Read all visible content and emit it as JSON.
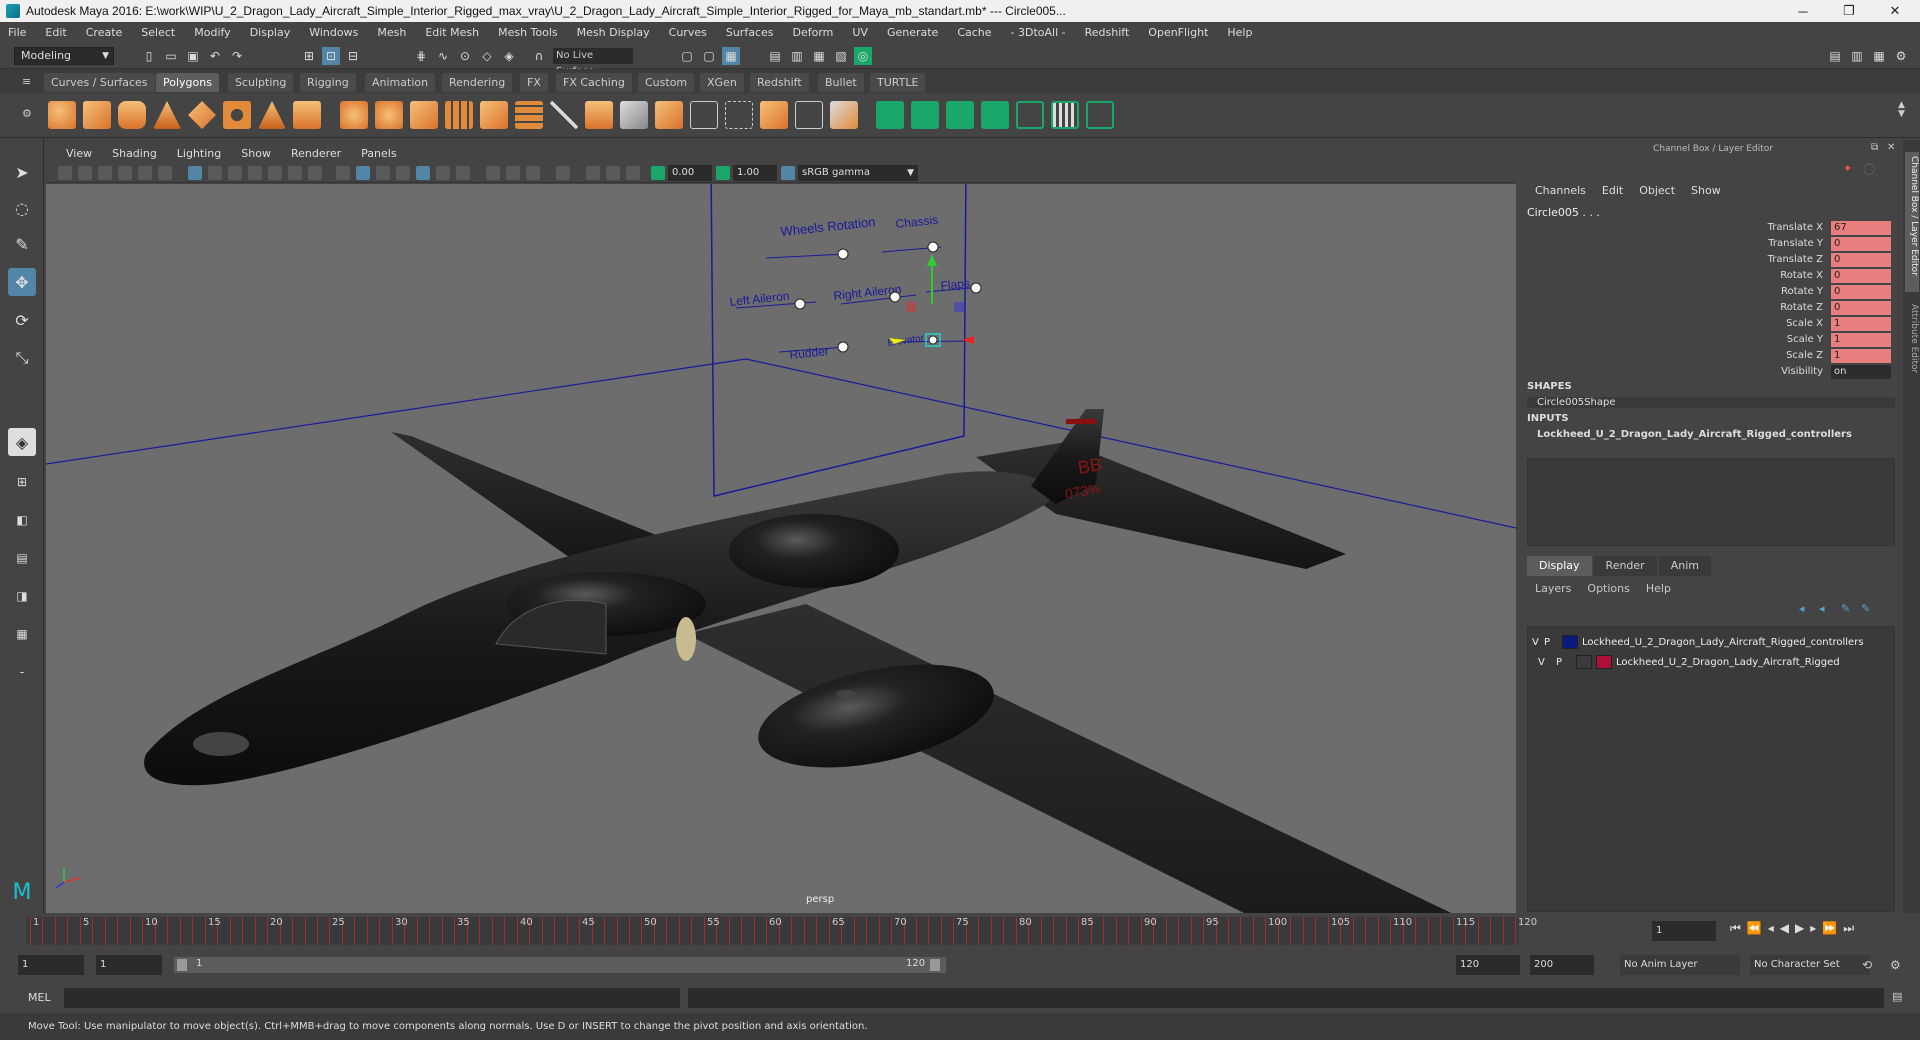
{
  "window": {
    "title": "Autodesk Maya 2016: E:\\work\\WIP\\U_2_Dragon_Lady_Aircraft_Simple_Interior_Rigged_max_vray\\U_2_Dragon_Lady_Aircraft_Simple_Interior_Rigged_for_Maya_mb_standart.mb*  ---  Circle005...",
    "minimize": "─",
    "restore": "❐",
    "close": "✕"
  },
  "menubar": [
    "File",
    "Edit",
    "Create",
    "Select",
    "Modify",
    "Display",
    "Windows",
    "Mesh",
    "Edit Mesh",
    "Mesh Tools",
    "Mesh Display",
    "Curves",
    "Surfaces",
    "Deform",
    "UV",
    "Generate",
    "Cache",
    "- 3DtoAll -",
    "Redshift",
    "OpenFlight",
    "Help"
  ],
  "status": {
    "mode": "Modeling",
    "live_surface": "No Live Surface"
  },
  "shelf_tabs": [
    "Curves / Surfaces",
    "Polygons",
    "Sculpting",
    "Rigging",
    "Animation",
    "Rendering",
    "FX",
    "FX Caching",
    "Custom",
    "XGen",
    "Redshift",
    "Bullet",
    "TURTLE"
  ],
  "shelf_active": "Polygons",
  "viewport": {
    "menu": [
      "View",
      "Shading",
      "Lighting",
      "Show",
      "Renderer",
      "Panels"
    ],
    "near": "0.00",
    "far": "1.00",
    "colorspace": "sRGB gamma",
    "camera_label": "persp",
    "controls": {
      "wheels_rotation": "Wheels Rotation",
      "chassis": "Chassis",
      "left_aileron": "Left Aileron",
      "right_aileron": "Right Aileron",
      "flaps": "Flaps",
      "rudder": "Rudder",
      "elevator": "Elevator"
    },
    "tail_code_top": "BB",
    "tail_code_bottom": "073%"
  },
  "channel_box": {
    "header": "Channel Box / Layer Editor",
    "menu": [
      "Channels",
      "Edit",
      "Object",
      "Show"
    ],
    "object": "Circle005 . . .",
    "attributes": [
      {
        "label": "Translate X",
        "value": "67",
        "highlight": true
      },
      {
        "label": "Translate Y",
        "value": "0",
        "highlight": true
      },
      {
        "label": "Translate Z",
        "value": "0",
        "highlight": true
      },
      {
        "label": "Rotate X",
        "value": "0",
        "highlight": true
      },
      {
        "label": "Rotate Y",
        "value": "0",
        "highlight": true
      },
      {
        "label": "Rotate Z",
        "value": "0",
        "highlight": true
      },
      {
        "label": "Scale X",
        "value": "1",
        "highlight": true
      },
      {
        "label": "Scale Y",
        "value": "1",
        "highlight": true
      },
      {
        "label": "Scale Z",
        "value": "1",
        "highlight": true
      },
      {
        "label": "Visibility",
        "value": "on",
        "highlight": false
      }
    ],
    "shapes_title": "SHAPES",
    "shape": "Circle005Shape",
    "inputs_title": "INPUTS",
    "input": "Lockheed_U_2_Dragon_Lady_Aircraft_Rigged_controllers"
  },
  "layer_editor": {
    "tabs": [
      "Display",
      "Render",
      "Anim"
    ],
    "menu": [
      "Layers",
      "Options",
      "Help"
    ],
    "layers": [
      {
        "v": "V",
        "p": "P",
        "name": "Lockheed_U_2_Dragon_Lady_Aircraft_Rigged_controllers",
        "color": "#0a1a80"
      },
      {
        "v": "V",
        "p": "P",
        "name": "Lockheed_U_2_Dragon_Lady_Aircraft_Rigged",
        "color": "#b0103a"
      }
    ]
  },
  "side_tabs": [
    "Channel Box / Layer Editor",
    "Attribute Editor"
  ],
  "timeline": {
    "ticks": [
      "1",
      "5",
      "10",
      "15",
      "20",
      "25",
      "30",
      "35",
      "40",
      "45",
      "50",
      "55",
      "60",
      "65",
      "70",
      "75",
      "80",
      "85",
      "90",
      "95",
      "100",
      "105",
      "110",
      "115",
      "120"
    ],
    "current_frame": "1"
  },
  "range": {
    "start": "1",
    "start_inner": "1",
    "slider_start": "1",
    "slider_end": "120",
    "end_inner": "120",
    "end": "200",
    "anim_layer": "No Anim Layer",
    "char_set": "No Character Set"
  },
  "mel_label": "MEL",
  "help_text": "Move Tool: Use manipulator to move object(s). Ctrl+MMB+drag to move components along normals. Use D or INSERT to change the pivot position and axis orientation."
}
